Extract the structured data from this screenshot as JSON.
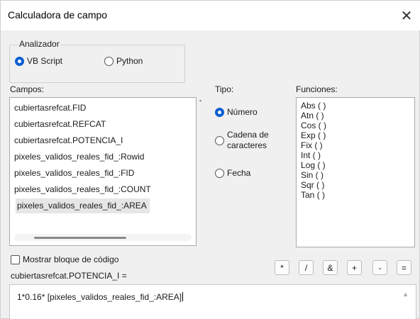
{
  "window": {
    "title": "Calculadora de campo",
    "close_symbol": "✕"
  },
  "parser": {
    "label": "Analizador",
    "options": [
      {
        "label": "VB Script",
        "checked": true
      },
      {
        "label": "Python",
        "checked": false
      }
    ]
  },
  "fields": {
    "label": "Campos:",
    "items": [
      {
        "label": "cubiertasrefcat.FID",
        "selected": false
      },
      {
        "label": "cubiertasrefcat.REFCAT",
        "selected": false
      },
      {
        "label": "cubiertasrefcat.POTENCIA_I",
        "selected": false
      },
      {
        "label": "pixeles_validos_reales_fid_:Rowid",
        "selected": false
      },
      {
        "label": "pixeles_validos_reales_fid_:FID",
        "selected": false
      },
      {
        "label": "pixeles_validos_reales_fid_:COUNT",
        "selected": false
      },
      {
        "label": "pixeles_validos_reales_fid_:AREA",
        "selected": true
      }
    ]
  },
  "type": {
    "label": "Tipo:",
    "options": [
      {
        "label": "Número",
        "checked": true
      },
      {
        "label": "Cadena de caracteres",
        "line1": "Cadena de",
        "line2": "caracteres",
        "checked": false
      },
      {
        "label": "Fecha",
        "checked": false
      }
    ]
  },
  "functions": {
    "label": "Funciones:",
    "items": [
      "Abs ( )",
      "Atn ( )",
      "Cos ( )",
      "Exp ( )",
      "Fix ( )",
      "Int ( )",
      "Log ( )",
      "Sin ( )",
      "Sqr ( )",
      "Tan ( )"
    ]
  },
  "code_block": {
    "label": "Mostrar bloque de código",
    "checked": false
  },
  "operators": [
    "*",
    "/",
    "&",
    "+",
    "-",
    "="
  ],
  "expression": {
    "target_label": "cubiertasrefcat.POTENCIA_I =",
    "value": "1*0.16* [pixeles_validos_reales_fid_:AREA]"
  },
  "colors": {
    "accent": "#0a5fd0",
    "background": "#f0f0f0",
    "selection": "#e6e6e6"
  }
}
